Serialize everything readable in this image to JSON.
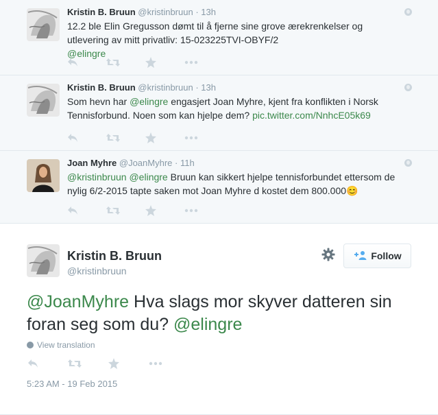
{
  "replies": [
    {
      "fullname": "Kristin B. Bruun",
      "username": "@kristinbruun",
      "separator": "·",
      "time": "13h",
      "text": "12.2 ble Elin Gregusson dømt til å fjerne sine grove ærekrenkelser og utlevering av mitt privatliv: 15-023225TVI-OBYF/2",
      "mention": "@elingre"
    },
    {
      "fullname": "Kristin B. Bruun",
      "username": "@kristinbruun",
      "separator": "·",
      "time": "13h",
      "text_before": "Som hevn har ",
      "mention": "@elingre",
      "text_after": " engasjert Joan Myhre, kjent fra konflikten i Norsk Tennisforbund. Noen som kan hjelpe dem? ",
      "link": "pic.twitter.com/NnhcE05k69"
    },
    {
      "fullname": "Joan Myhre",
      "username": "@JoanMyhre",
      "separator": "·",
      "time": "11h",
      "mention1": "@kristinbruun",
      "mention2": "@elingre",
      "text": " Bruun kan sikkert hjelpe tennisforbundet ettersom de nylig 6/2-2015 tapte saken mot Joan Myhre d kostet dem 800.000",
      "emoji": "😊"
    }
  ],
  "main_tweet": {
    "fullname": "Kristin B. Bruun",
    "username": "@kristinbruun",
    "follow_label": "Follow",
    "mention1": "@JoanMyhre",
    "text": " Hva slags mor skyver datteren sin foran seg som du? ",
    "mention2": "@elingre",
    "view_translation": "View translation",
    "timestamp": "5:23 AM - 19 Feb 2015"
  },
  "icons": [
    "reply-icon",
    "retweet-icon",
    "favorite-icon",
    "more-icon",
    "globe-icon",
    "gear-icon",
    "follow-user-icon"
  ],
  "colors": {
    "link": "#3b884b",
    "muted": "#8899a6",
    "text": "#292f33",
    "reply_bg": "#f5f8fa"
  }
}
